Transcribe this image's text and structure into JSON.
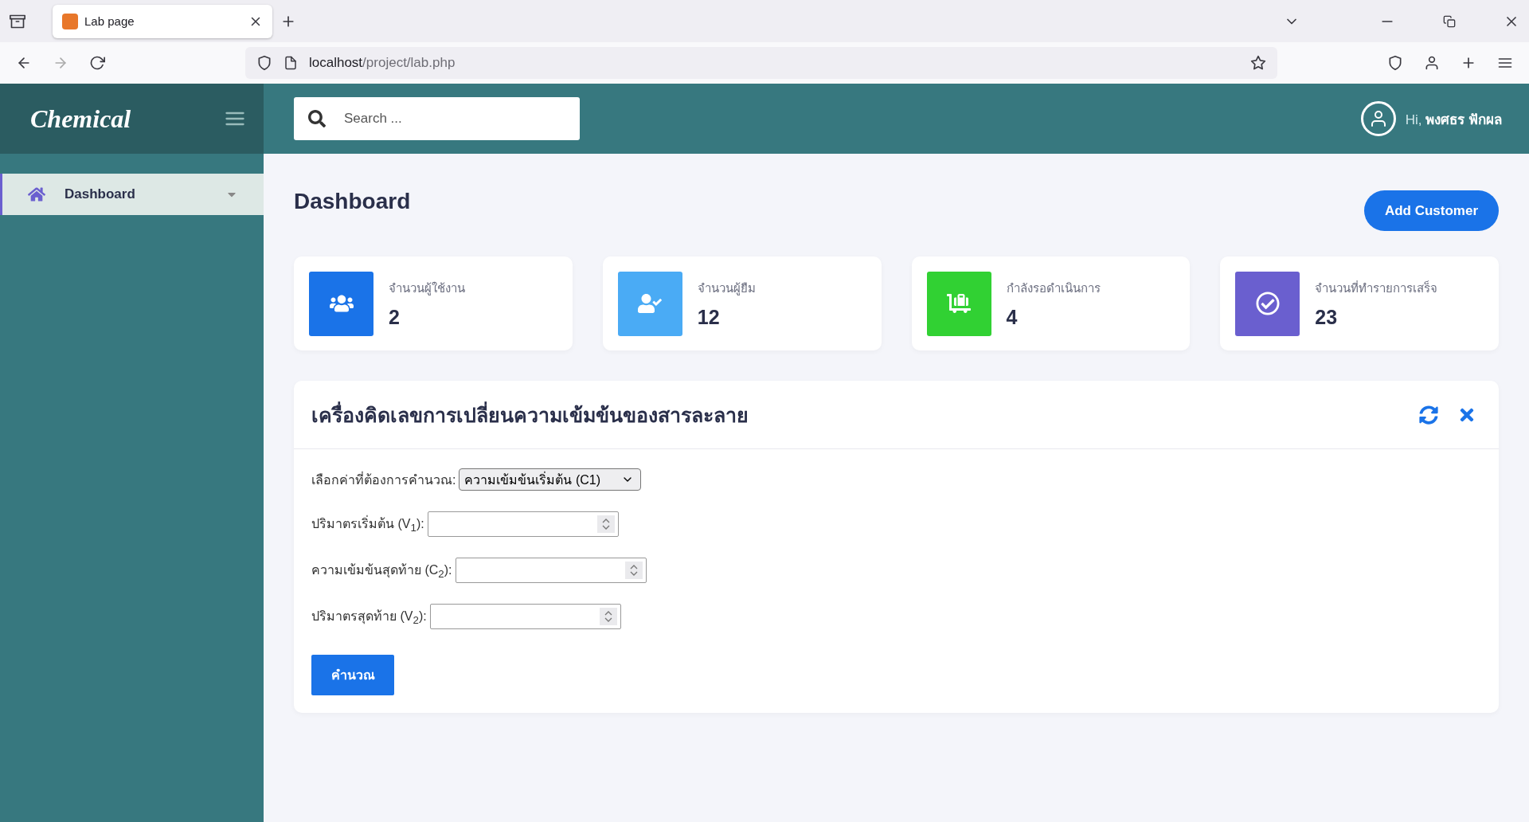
{
  "browser": {
    "tabs": [
      {
        "title": "Lab page",
        "selected": true
      }
    ],
    "url": {
      "host": "localhost",
      "path": "/project/lab.php"
    }
  },
  "sidebar": {
    "logo": "Chemical",
    "items": [
      {
        "label": "Dashboard",
        "selected": true
      }
    ]
  },
  "header": {
    "search": {
      "placeholder": "Search ..."
    },
    "greeting": "Hi,",
    "user_name": "พงศธร ฟักผล"
  },
  "page": {
    "title": "Dashboard",
    "add_button": "Add Customer"
  },
  "stats": [
    {
      "label": "จำนวนผู้ใช้งาน",
      "value": "2",
      "color": "#1a73e8"
    },
    {
      "label": "จำนวนผู้ยืม",
      "value": "12",
      "color": "#4aabf5"
    },
    {
      "label": "กำลังรอดำเนินการ",
      "value": "4",
      "color": "#31d133"
    },
    {
      "label": "จำนวนที่ทำรายการเสร็จ",
      "value": "23",
      "color": "#6a5fcf"
    }
  ],
  "calculator": {
    "title": "เครื่องคิดเลขการเปลี่ยนความเข้มข้นของสารละลาย",
    "select_label": "เลือกค่าที่ต้องการคำนวณ:",
    "select_value": "ความเข้มข้นเริ่มต้น (C1)",
    "fields": [
      {
        "label": "ปริมาตรเริ่มต้น (V$_{1}$):"
      },
      {
        "label": "ความเข้มข้นสุดท้าย (C$_{2}$):"
      },
      {
        "label": "ปริมาตรสุดท้าย (V$_{2}$):"
      }
    ],
    "submit": "คำนวณ"
  }
}
